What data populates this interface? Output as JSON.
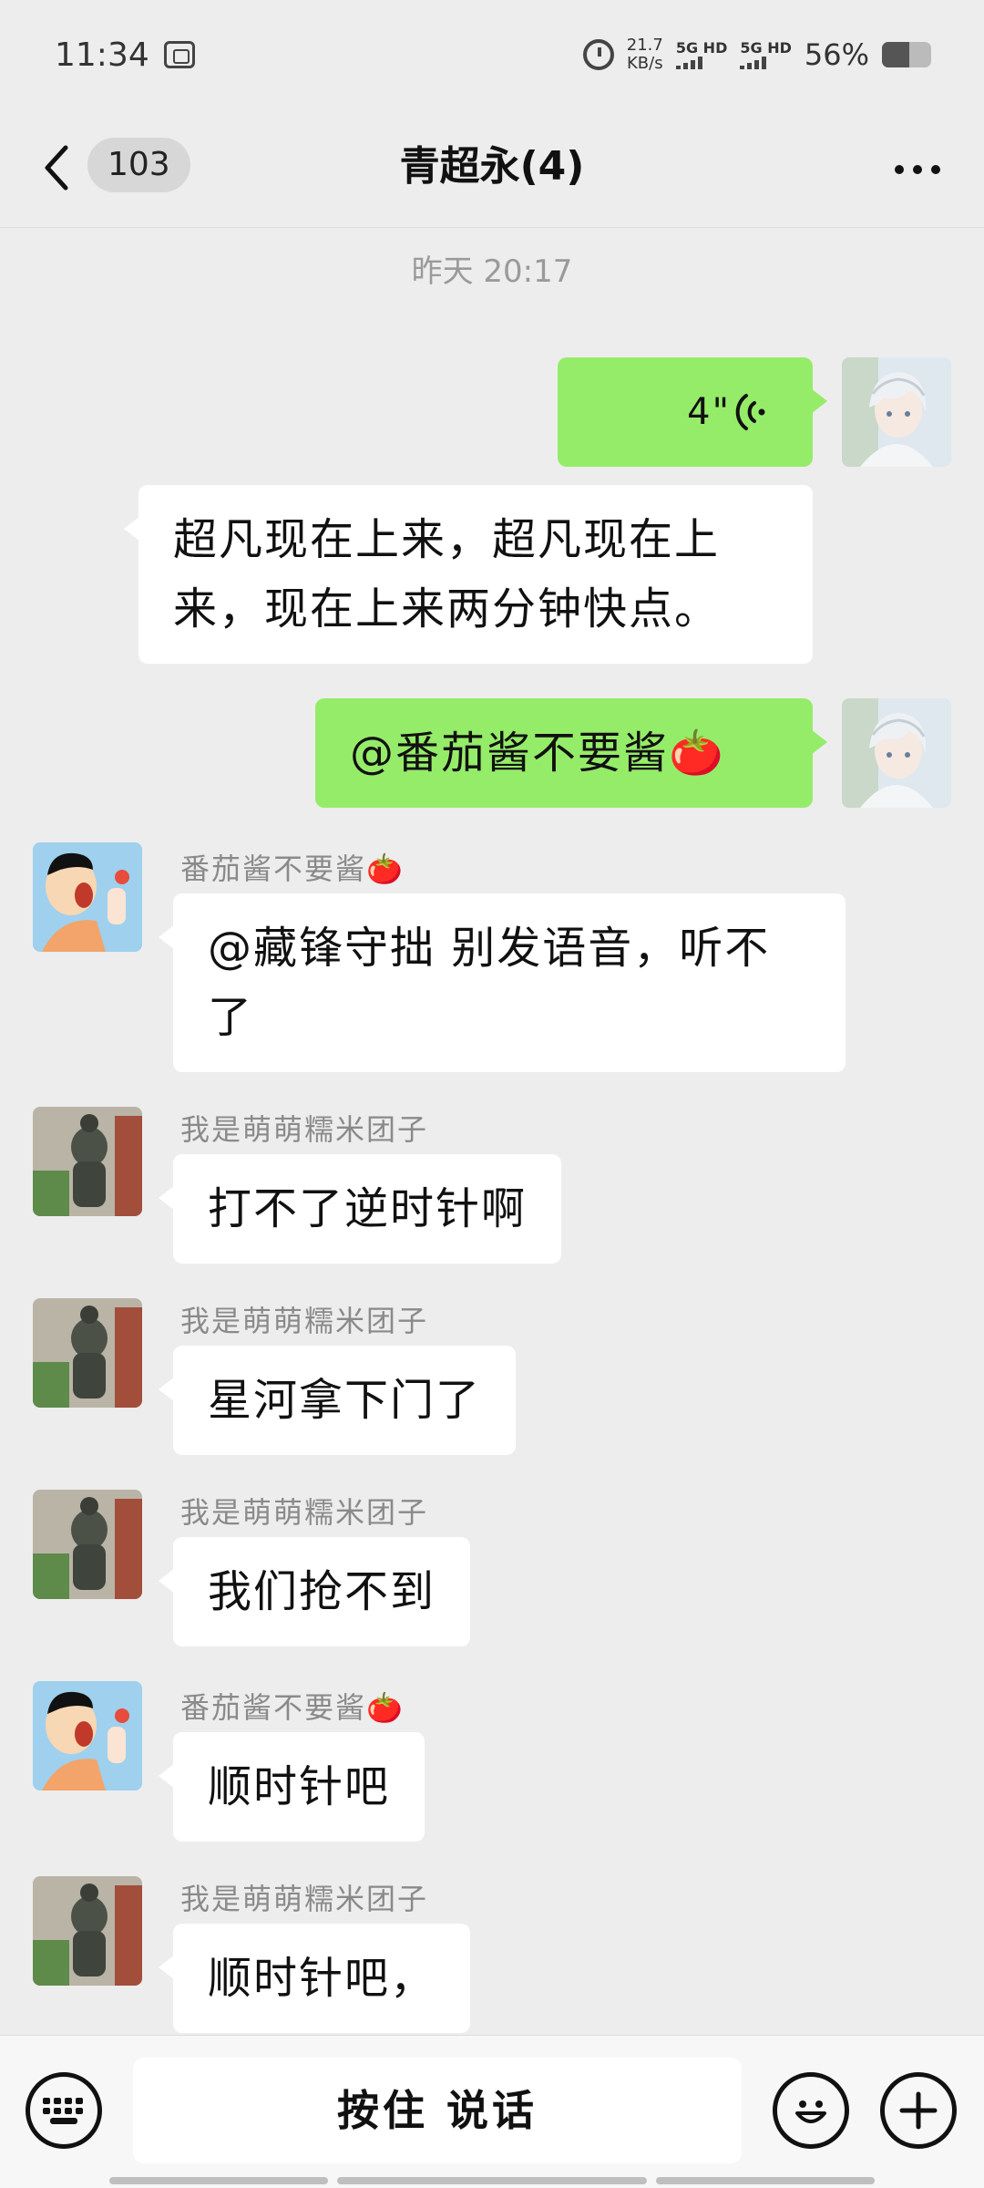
{
  "status_bar": {
    "time": "11:34",
    "speed_value": "21.7",
    "speed_unit": "KB/s",
    "net1": "5G HD",
    "net2": "5G HD",
    "battery": "56%"
  },
  "nav": {
    "unread": "103",
    "title": "青超永(4)"
  },
  "timestamp": "昨天 20:17",
  "messages": [
    {
      "type": "voice-out",
      "duration": "4\""
    },
    {
      "type": "in",
      "text": "超凡现在上来，超凡现在上来，现在上来两分钟快点。"
    },
    {
      "type": "out",
      "text": "@番茄酱不要酱🍅"
    },
    {
      "type": "in",
      "sender": "番茄酱不要酱🍅",
      "text": "@藏锋守拙  别发语音，听不了"
    },
    {
      "type": "in",
      "sender": "我是萌萌糯米团子",
      "text": "打不了逆时针啊"
    },
    {
      "type": "in",
      "sender": "我是萌萌糯米团子",
      "text": "星河拿下门了"
    },
    {
      "type": "in",
      "sender": "我是萌萌糯米团子",
      "text": "我们抢不到"
    },
    {
      "type": "in",
      "sender": "番茄酱不要酱🍅",
      "text": "顺时针吧"
    },
    {
      "type": "in",
      "sender": "我是萌萌糯米团子",
      "text": "顺时针吧，"
    }
  ],
  "input": {
    "hold_to_talk": "按住 说话"
  },
  "colors": {
    "out_bubble": "#95ec69",
    "in_bubble": "#ffffff",
    "background": "#ededed"
  }
}
